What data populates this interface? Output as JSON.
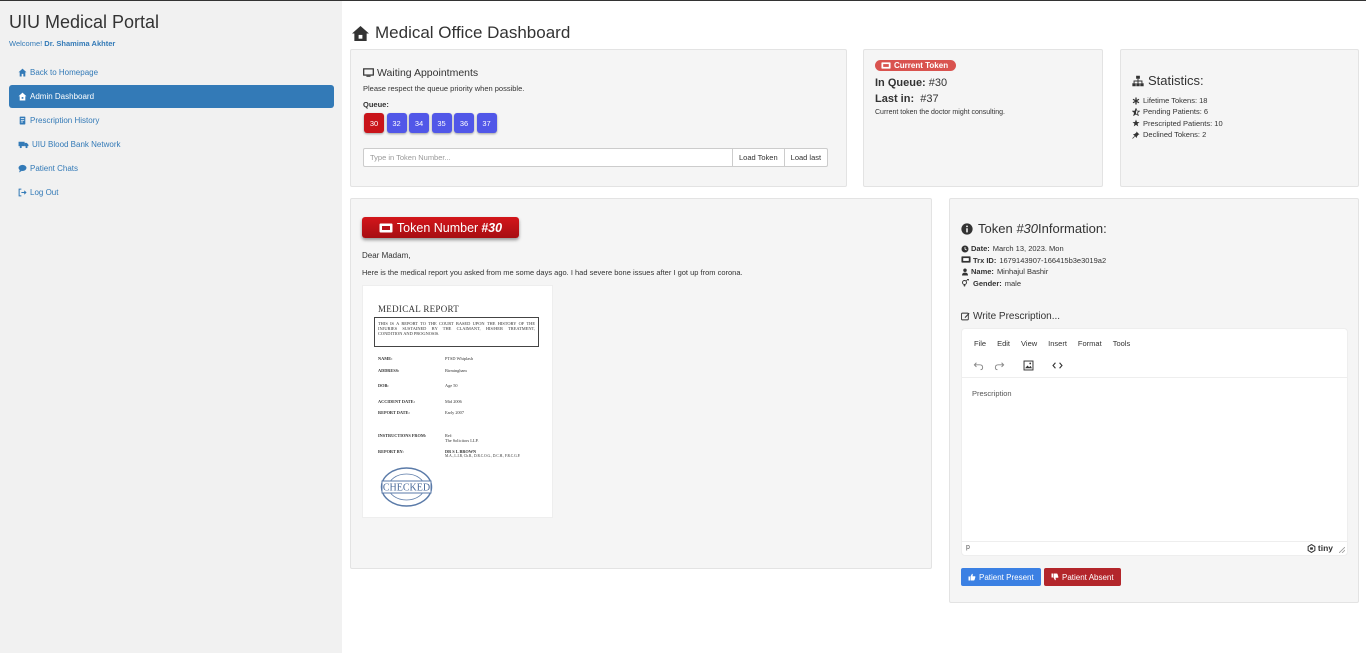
{
  "sidebar": {
    "brand": "UIU Medical Portal",
    "welcome_prefix": "Welcome! ",
    "welcome_name": "Dr. Shamima Akhter",
    "items": [
      {
        "label": "Back to Homepage",
        "icon": "home-icon"
      },
      {
        "label": "Admin Dashboard",
        "icon": "home-icon",
        "active": true
      },
      {
        "label": "Prescription History",
        "icon": "document-icon"
      },
      {
        "label": "UIU Blood Bank Network",
        "icon": "truck-icon"
      },
      {
        "label": "Patient Chats",
        "icon": "chat-icon"
      },
      {
        "label": "Log Out",
        "icon": "logout-icon"
      }
    ]
  },
  "header": {
    "title": "Medical Office Dashboard",
    "icon": "home-icon"
  },
  "waiting": {
    "title": "Waiting Appointments",
    "note": "Please respect the queue priority when possible.",
    "queue_label": "Queue:",
    "queue": [
      "30",
      "32",
      "34",
      "35",
      "36",
      "37"
    ],
    "input_placeholder": "Type in Token Number...",
    "load_token": "Load Token",
    "load_last": "Load last"
  },
  "current": {
    "badge": "Current Token",
    "in_queue_label": "In Queue:",
    "in_queue_value": "#30",
    "last_in_label": "Last in:",
    "last_in_value": "#37",
    "note": "Current token the doctor might consulting."
  },
  "stats": {
    "title": "Statistics:",
    "items": [
      {
        "label": "Lifetime Tokens: 18",
        "icon": "asterisk-icon"
      },
      {
        "label": "Pending Patients: 6",
        "icon": "star-half-icon"
      },
      {
        "label": "Prescripted Patients: 10",
        "icon": "star-icon"
      },
      {
        "label": "Declined Tokens: 2",
        "icon": "thumbtack-icon"
      }
    ]
  },
  "report": {
    "banner_prefix": "Token Number",
    "banner_number": "#30",
    "greeting": "Dear Madam,",
    "body": "Here is the medical report you asked from me some days ago. I had severe bone issues after I got up from corona.",
    "doc": {
      "title": "MEDICAL REPORT",
      "box_text": "THIS IS A REPORT TO THE COURT BASED UPON THE HISTORY OF THE INJURIES SUSTAINED BY THE CLAIMANT, HIS/HER TREATMENT, CONDITION AND PROGNOSIS.",
      "fields": [
        {
          "k": "NAME:",
          "v": "PTSD Whiplash"
        },
        {
          "k": "ADDRESS:",
          "v": "Birmingham"
        },
        {
          "k": "DOB:",
          "v": "Age 50"
        },
        {
          "k": "ACCIDENT DATE:",
          "v": "Mid 2006"
        },
        {
          "k": "REPORT DATE:",
          "v": "Early 2007"
        },
        {
          "k": "INSTRUCTIONS FROM:",
          "v": "Ref:"
        },
        {
          "k": "",
          "v": "The Solicitors LLP."
        },
        {
          "k": "REPORT BY:",
          "v": "DR S L BROWN"
        },
        {
          "k": "",
          "v": "M.A., L.I.B, Ch.B., D.R.C.O.G., D.C.H., F.R.C.G.P."
        }
      ],
      "stamp": "CHECKED"
    }
  },
  "info": {
    "title_prefix": "Token ",
    "title_number": "#30",
    "title_suffix": " Information:",
    "date_label": "Date:",
    "date_value": "March 13, 2023. Mon",
    "trx_label": "Trx ID:",
    "trx_value": "1679143907-166415b3e3019a2",
    "name_label": "Name:",
    "name_value": "Minhajul Bashir",
    "gender_label": "Gender:",
    "gender_value": "male",
    "write_title": "Write Prescription...",
    "editor": {
      "menu": [
        "File",
        "Edit",
        "View",
        "Insert",
        "Format",
        "Tools"
      ],
      "placeholder": "Prescription",
      "path": "p",
      "brand": "tiny"
    },
    "present_label": "Patient Present",
    "absent_label": "Patient Absent"
  },
  "colors": {
    "primary": "#337ab7",
    "queue_active": "#c9141a",
    "queue_default": "#5157e8",
    "danger": "#d9534f",
    "present": "#3b80e3",
    "absent": "#b3262b"
  }
}
